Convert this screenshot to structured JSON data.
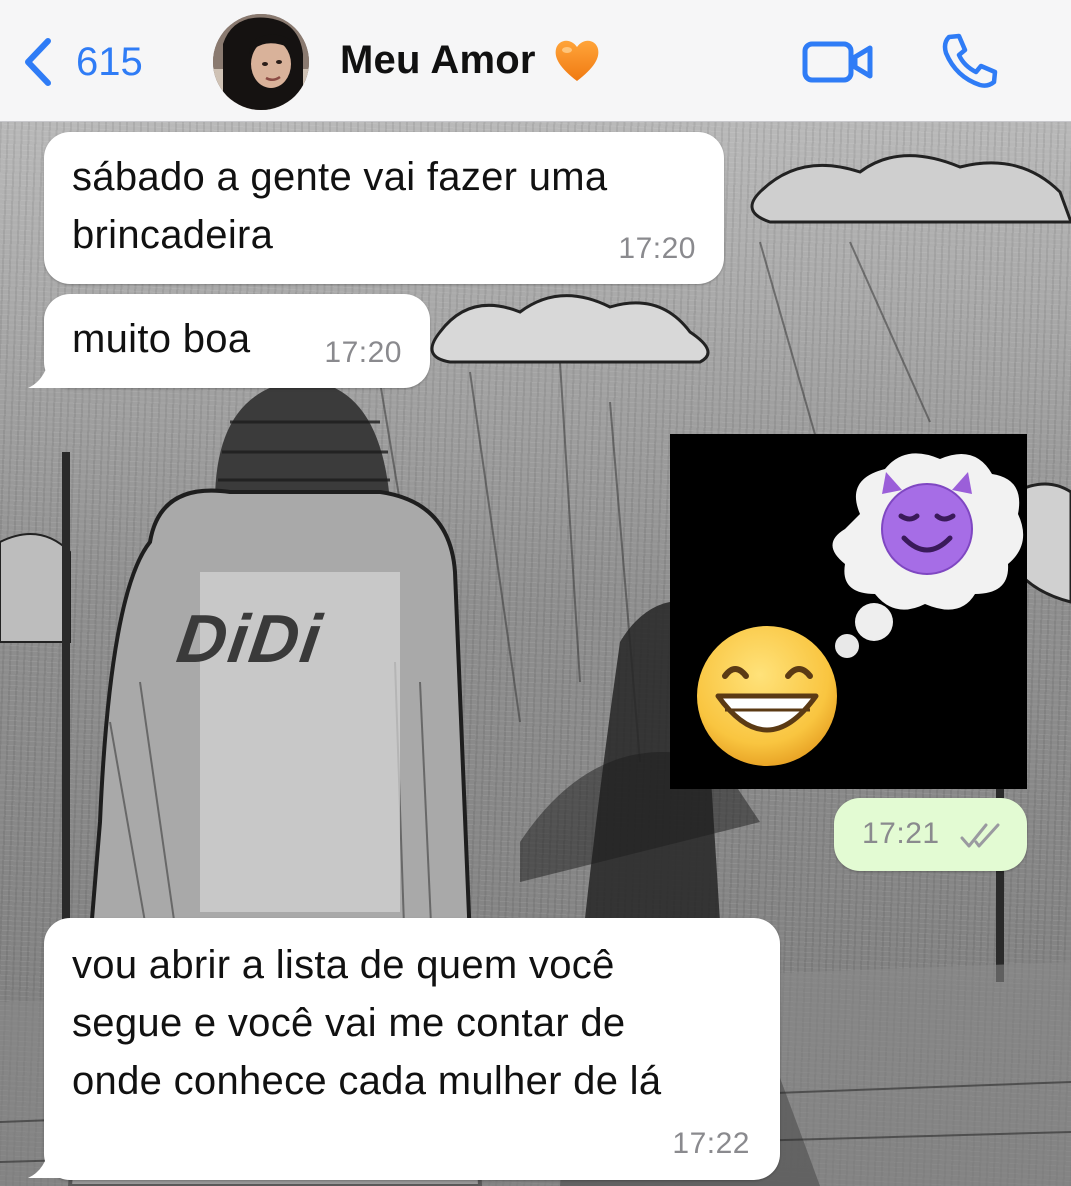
{
  "header": {
    "back_count": "615",
    "contact_name": "Meu Amor",
    "name_emoji": "🧡"
  },
  "messages": [
    {
      "direction": "in",
      "text_lines": [
        "sábado a gente vai fazer uma",
        "brincadeira"
      ],
      "time": "17:20"
    },
    {
      "direction": "in",
      "text_lines": [
        "muito boa"
      ],
      "time": "17:20"
    },
    {
      "direction": "out",
      "type": "image",
      "time": "17:21",
      "status": "read"
    },
    {
      "direction": "in",
      "text_lines": [
        "vou abrir a lista de quem você",
        "segue e você vai me contar de",
        "onde conhece cada mulher de lá"
      ],
      "time": "17:22"
    }
  ],
  "wallpaper_text": "DiDi",
  "colors": {
    "accent": "#2f7cf6",
    "incoming_bubble": "#ffffff",
    "outgoing_bubble": "#e3fbd3",
    "timestamp": "#8a8a8e"
  },
  "icons": [
    "chevron-left-icon",
    "video-camera-icon",
    "phone-icon",
    "double-check-icon",
    "orange-heart-emoji",
    "smiling-devil-emoji",
    "grinning-face-emoji",
    "thought-bubble"
  ]
}
